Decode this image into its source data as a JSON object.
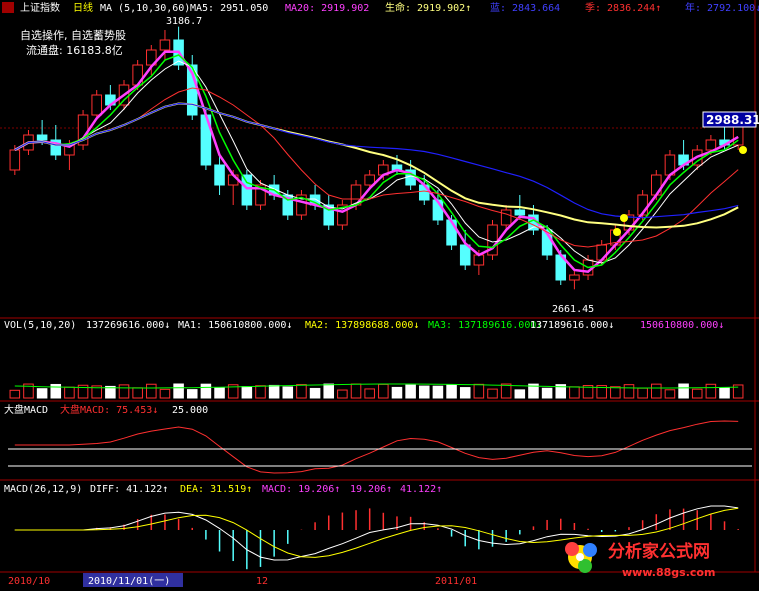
{
  "header": {
    "index_name": "上证指数",
    "period": "日线",
    "ma_label": "MA (5,10,30,60)",
    "ma5": "MA5: 2951.050",
    "ma20": "MA20: 2919.902",
    "life": "生命: 2919.902↑",
    "blue": "蓝: 2843.664",
    "season": "季: 2836.244↑",
    "year": "年: 2792.100↓"
  },
  "overlay": {
    "line1": "自选操作, 自选蓄势股",
    "line2": "流通盘: 16183.8亿",
    "high_marker": "3186.7",
    "current_price": "2988.31",
    "low_marker": "2661.45"
  },
  "vol_panel": {
    "title": "VOL(5,10,20)",
    "v1": "137269616.000↓",
    "ma1": "MA1: 150610800.000↓",
    "ma2": "MA2: 137898688.000↓",
    "ma3": "MA3: 137189616.000↓",
    "v5": "137189616.000↓",
    "v6": "150610800.000↓"
  },
  "dapan_panel": {
    "title": "大盘MACD",
    "title2": "大盘MACD: 75.453↓",
    "value": "25.000"
  },
  "macd_panel": {
    "title": "MACD(26,12,9)",
    "diff": "DIFF: 41.122↑",
    "dea": "DEA: 31.519↑",
    "macd": "MACD: 19.206↑",
    "v4": "19.206↑",
    "v5": "41.122↑"
  },
  "date_axis": {
    "d1": "2010/10",
    "d2": "2010/11/01(一)",
    "d3": "12",
    "d4": "2011/01"
  },
  "watermark": {
    "brand": "分析家公式网",
    "url": "www.88gs.com"
  },
  "colors": {
    "up": "#ff3030",
    "down": "#55ffff",
    "ma5": "#ffffff",
    "ma_magenta": "#ff40ff",
    "ma_green": "#00ff00",
    "life_yellow": "#ffff80",
    "blue_line": "#2020ff"
  },
  "chart_data": {
    "type": "candlestick",
    "title": "上证指数 日线",
    "ylim": [
      2620,
      3200
    ],
    "x_categories_note": "trading days 2010/10 to 2011/02",
    "ohlc": [
      [
        2900,
        2950,
        2890,
        2940
      ],
      [
        2940,
        2980,
        2930,
        2970
      ],
      [
        2970,
        3000,
        2950,
        2960
      ],
      [
        2960,
        2990,
        2920,
        2930
      ],
      [
        2930,
        2960,
        2900,
        2950
      ],
      [
        2950,
        3020,
        2940,
        3010
      ],
      [
        3010,
        3060,
        3000,
        3050
      ],
      [
        3050,
        3070,
        3020,
        3030
      ],
      [
        3030,
        3080,
        3020,
        3070
      ],
      [
        3070,
        3120,
        3060,
        3110
      ],
      [
        3110,
        3150,
        3090,
        3140
      ],
      [
        3140,
        3180,
        3120,
        3160
      ],
      [
        3160,
        3186.7,
        3100,
        3110
      ],
      [
        3110,
        3130,
        3000,
        3010
      ],
      [
        3010,
        3020,
        2900,
        2910
      ],
      [
        2910,
        2930,
        2850,
        2870
      ],
      [
        2870,
        2900,
        2830,
        2890
      ],
      [
        2890,
        2900,
        2820,
        2830
      ],
      [
        2830,
        2880,
        2820,
        2870
      ],
      [
        2870,
        2890,
        2840,
        2850
      ],
      [
        2850,
        2860,
        2800,
        2810
      ],
      [
        2810,
        2860,
        2800,
        2850
      ],
      [
        2850,
        2870,
        2820,
        2830
      ],
      [
        2830,
        2850,
        2780,
        2790
      ],
      [
        2790,
        2840,
        2780,
        2830
      ],
      [
        2830,
        2880,
        2820,
        2870
      ],
      [
        2870,
        2900,
        2860,
        2890
      ],
      [
        2890,
        2920,
        2880,
        2910
      ],
      [
        2910,
        2930,
        2890,
        2900
      ],
      [
        2900,
        2920,
        2860,
        2870
      ],
      [
        2870,
        2890,
        2830,
        2840
      ],
      [
        2840,
        2860,
        2790,
        2800
      ],
      [
        2800,
        2810,
        2740,
        2750
      ],
      [
        2750,
        2780,
        2700,
        2710
      ],
      [
        2710,
        2740,
        2690,
        2730
      ],
      [
        2730,
        2800,
        2720,
        2790
      ],
      [
        2790,
        2830,
        2780,
        2820
      ],
      [
        2820,
        2850,
        2800,
        2810
      ],
      [
        2810,
        2830,
        2770,
        2780
      ],
      [
        2780,
        2790,
        2720,
        2730
      ],
      [
        2730,
        2740,
        2670,
        2680
      ],
      [
        2680,
        2700,
        2661.45,
        2690
      ],
      [
        2690,
        2730,
        2680,
        2720
      ],
      [
        2720,
        2760,
        2710,
        2750
      ],
      [
        2750,
        2790,
        2740,
        2780
      ],
      [
        2780,
        2820,
        2770,
        2810
      ],
      [
        2810,
        2860,
        2800,
        2850
      ],
      [
        2850,
        2900,
        2840,
        2890
      ],
      [
        2890,
        2940,
        2880,
        2930
      ],
      [
        2930,
        2960,
        2900,
        2910
      ],
      [
        2910,
        2950,
        2900,
        2940
      ],
      [
        2940,
        2970,
        2930,
        2960
      ],
      [
        2960,
        2990,
        2940,
        2950
      ],
      [
        2950,
        2988.31,
        2940,
        2988.31
      ]
    ],
    "series": [
      {
        "name": "MA5",
        "color": "#ffffff"
      },
      {
        "name": "MA20",
        "color": "#ff40ff"
      },
      {
        "name": "生命",
        "color": "#ffff80"
      },
      {
        "name": "季",
        "color": "#ff3030"
      },
      {
        "name": "年",
        "color": "#2020ff"
      }
    ],
    "annotations": [
      "3186.7",
      "2661.45",
      "2988.31"
    ]
  }
}
